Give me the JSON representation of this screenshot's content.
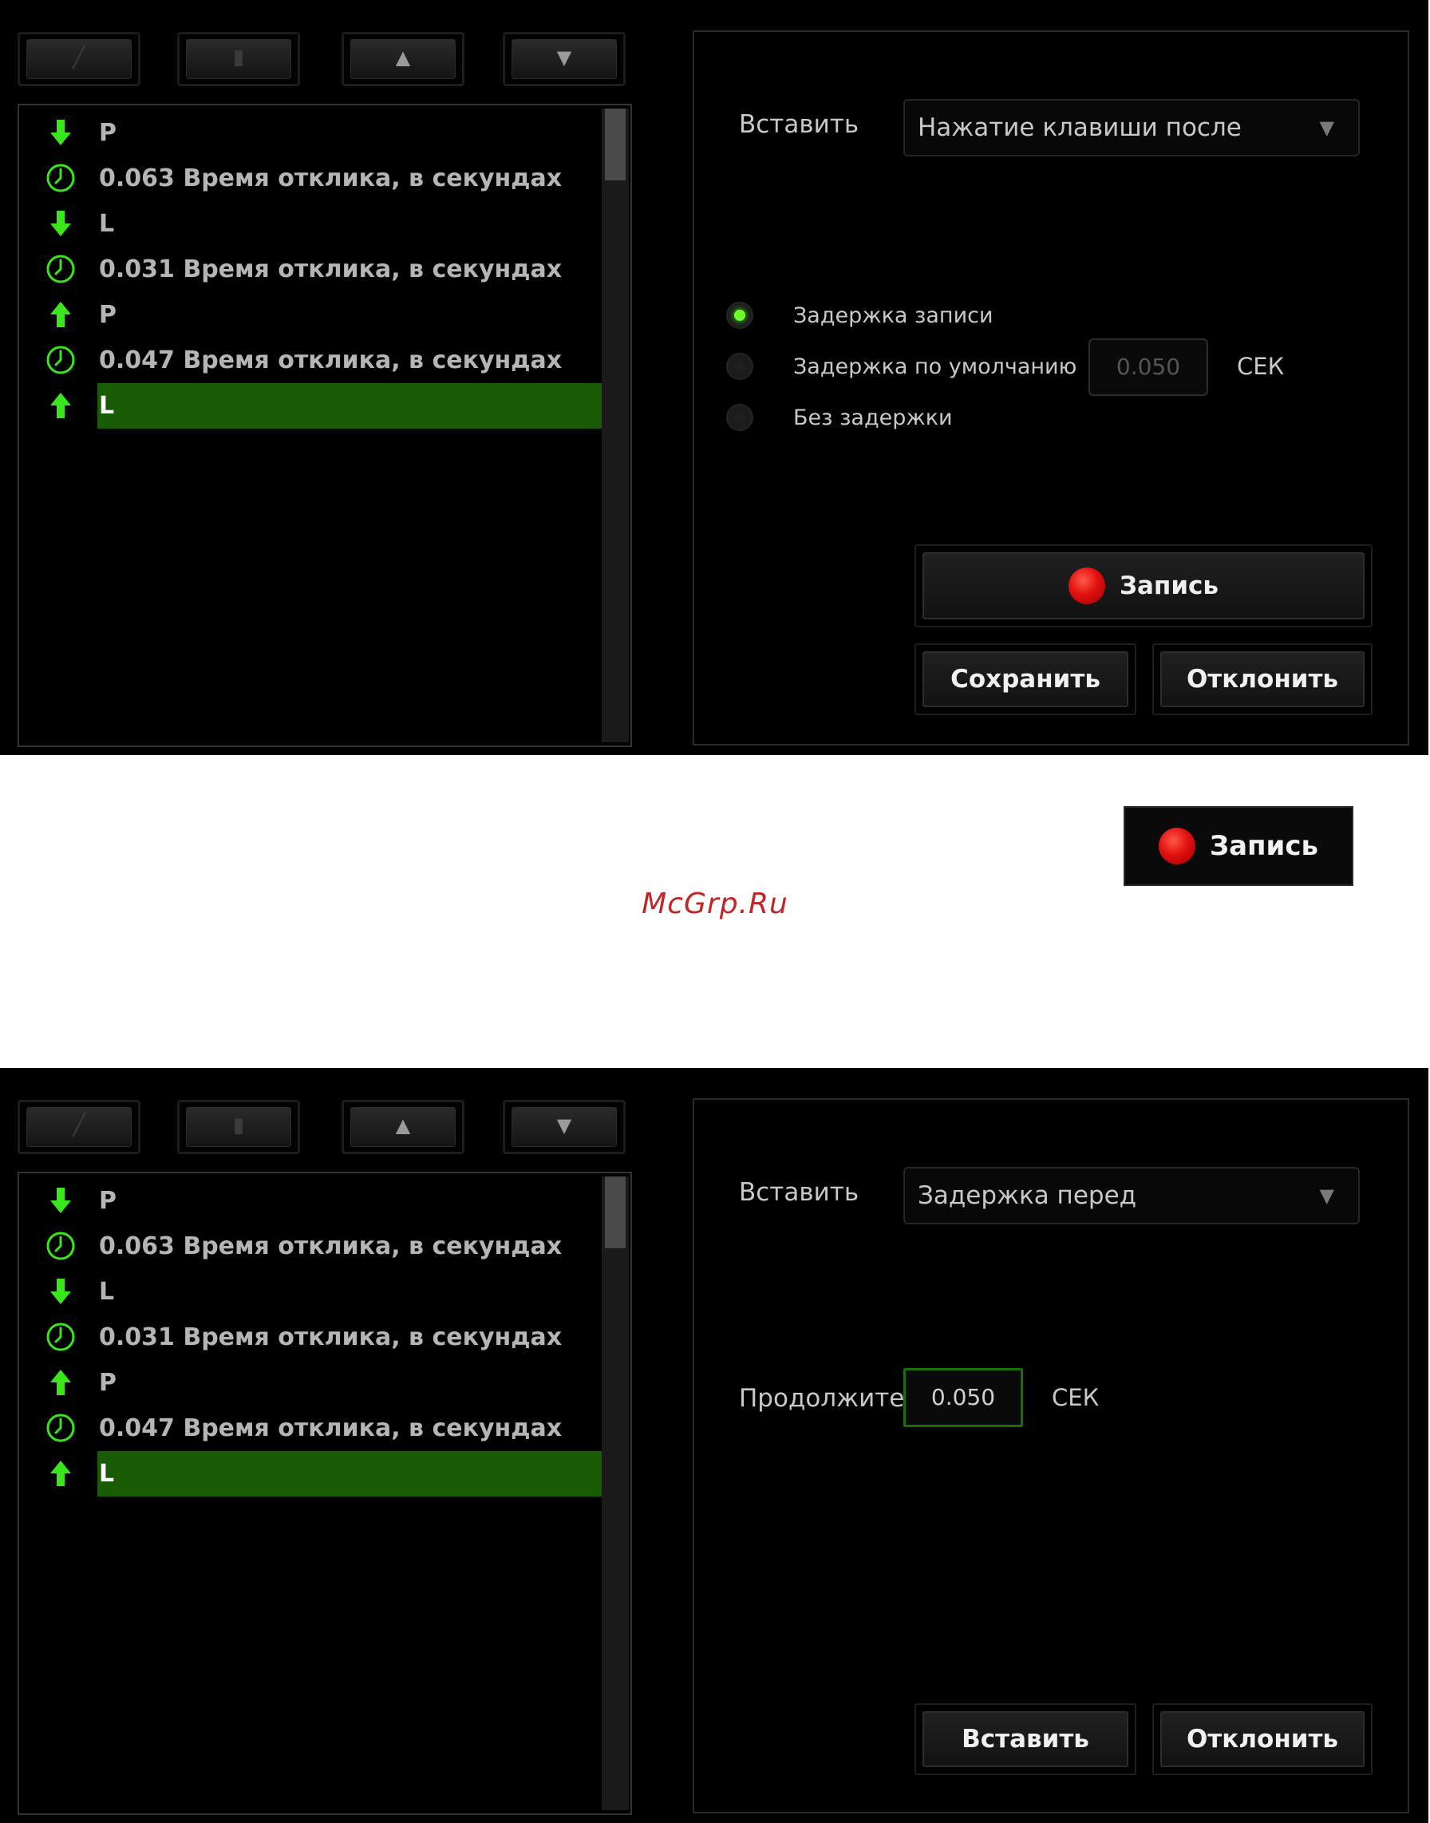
{
  "colors": {
    "accent_green": "#6dff2a",
    "selection_green": "#1a5b07",
    "record_red": "#e01010",
    "watermark_red": "#bf2626"
  },
  "toolbar_icons": [
    "pencil-icon",
    "trash-icon",
    "move-up-icon",
    "move-down-icon"
  ],
  "macro_list": [
    {
      "icon": "key-down-icon",
      "text": "P"
    },
    {
      "icon": "clock-icon",
      "text": "0.063 Время отклика, в секундах"
    },
    {
      "icon": "key-down-icon",
      "text": "L"
    },
    {
      "icon": "clock-icon",
      "text": "0.031 Время отклика, в секундах"
    },
    {
      "icon": "key-up-icon",
      "text": "P"
    },
    {
      "icon": "clock-icon",
      "text": "0.047 Время отклика, в секундах"
    },
    {
      "icon": "key-up-icon",
      "text": "L",
      "selected": true
    }
  ],
  "panel1": {
    "insert_label": "Вставить",
    "insert_value": "Нажатие клавиши после",
    "radio_options": [
      {
        "label": "Задержка записи",
        "selected": true
      },
      {
        "label": "Задержка по умолчанию",
        "selected": false
      },
      {
        "label": "Без задержки",
        "selected": false
      }
    ],
    "default_delay_value": "0.050",
    "unit": "СЕК",
    "record_label": "Запись",
    "save_label": "Сохранить",
    "cancel_label": "Отклонить"
  },
  "standalone_record_label": "Запись",
  "watermark": "McGrp.Ru",
  "panel2": {
    "insert_label": "Вставить",
    "insert_value": "Задержка перед",
    "duration_label": "Продолжите",
    "duration_value": "0.050",
    "unit": "СЕК",
    "insert_button_label": "Вставить",
    "cancel_label": "Отклонить"
  }
}
